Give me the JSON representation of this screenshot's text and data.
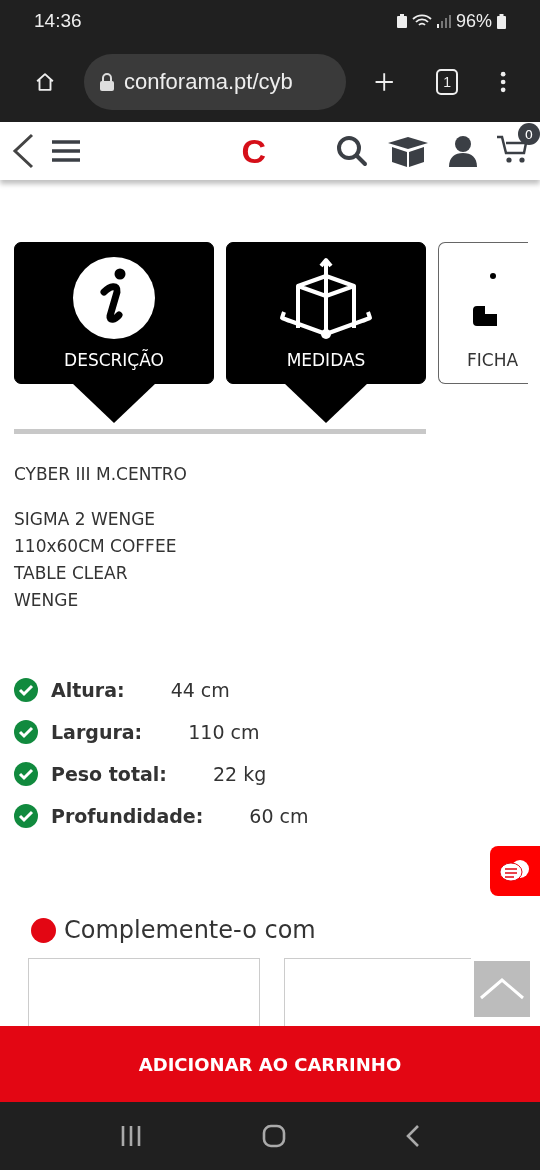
{
  "status_bar": {
    "time": "14:36",
    "battery": "96%"
  },
  "browser": {
    "url": "conforama.pt/cyb",
    "tab_count": "1"
  },
  "header": {
    "logo": "C",
    "cart_count": "0"
  },
  "tabs": [
    {
      "kind": "info",
      "label": "DESCRIÇÃO",
      "selected": true
    },
    {
      "kind": "dimensions",
      "label": "MEDIDAS",
      "selected": true
    },
    {
      "kind": "sheet",
      "label": "FICHA",
      "selected": false
    }
  ],
  "product": {
    "name": "CYBER III M.CENTRO",
    "description": [
      "SIGMA 2 WENGE",
      "110x60CM COFFEE",
      "TABLE CLEAR",
      "WENGE"
    ]
  },
  "specs": [
    {
      "label": "Altura:",
      "value": "44 cm"
    },
    {
      "label": "Largura:",
      "value": "110 cm"
    },
    {
      "label": "Peso total:",
      "value": "22 kg"
    },
    {
      "label": "Profundidade:",
      "value": "60 cm"
    }
  ],
  "complement": {
    "title": "Complemente-o com"
  },
  "add_to_cart": "ADICIONAR AO CARRINHO"
}
